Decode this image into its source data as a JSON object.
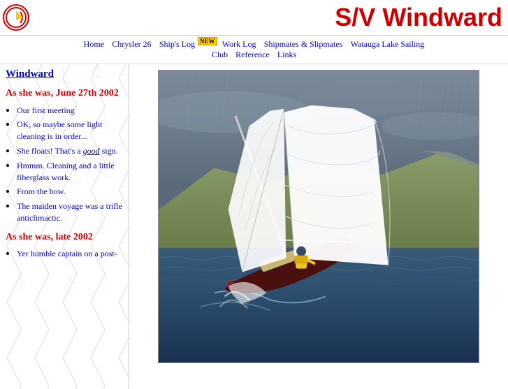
{
  "header": {
    "title": "S/V Windward",
    "logo_alt": "S/V Windward Logo"
  },
  "nav": {
    "items": [
      {
        "label": "Home",
        "href": "#"
      },
      {
        "label": "Chrysler 26",
        "href": "#"
      },
      {
        "label": "Ship's Log",
        "href": "#",
        "badge": "NEW"
      },
      {
        "label": "Work Log",
        "href": "#"
      },
      {
        "label": "Shipmates & Slipmates",
        "href": "#"
      },
      {
        "label": "Watauga Lake Sailing Club",
        "href": "#"
      },
      {
        "label": "Reference",
        "href": "#"
      },
      {
        "label": "Links",
        "href": "#"
      }
    ]
  },
  "sidebar": {
    "title": "Windward",
    "sections": [
      {
        "heading": "As she was, June 27th 2002",
        "links": [
          {
            "label": "Our first meeting"
          },
          {
            "label": "OK, so maybe some light cleaning is in order..."
          },
          {
            "label": "She floats! That's a good sign.",
            "italic_part": "good"
          },
          {
            "label": "Hmmm. Cleaning and a little fiberglass work."
          },
          {
            "label": "From the bow."
          },
          {
            "label": "The maiden voyage was a trifle anticlimactic."
          }
        ]
      },
      {
        "heading": "As she was, late 2002",
        "links": [
          {
            "label": "Yer humble captain on a post-"
          }
        ]
      }
    ]
  },
  "main_image": {
    "alt": "Sailboat heeling in wind on water",
    "description": "S/V Windward sailing photo"
  },
  "colors": {
    "accent_red": "#cc0000",
    "link_blue": "#0000cc",
    "nav_bg": "#ffffff"
  }
}
